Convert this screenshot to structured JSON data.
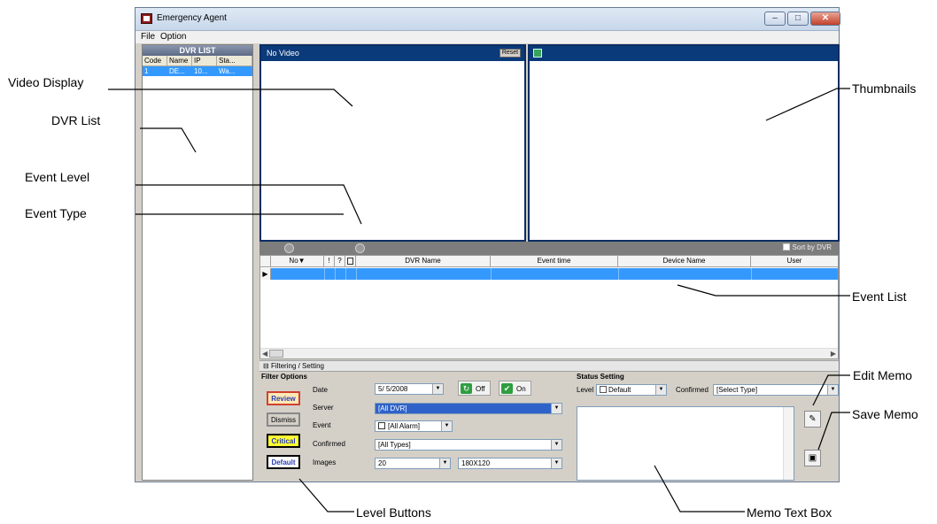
{
  "window": {
    "title": "Emergency Agent",
    "menu": [
      "File",
      "Option"
    ]
  },
  "dvr_list": {
    "header": "DVR LIST",
    "columns": [
      "Code",
      "Name",
      "IP",
      "Sta..."
    ],
    "rows": [
      [
        "1",
        "DE...",
        "10...",
        "Wa..."
      ]
    ]
  },
  "video": {
    "title": "No Video",
    "reset_label": "Reset"
  },
  "event_list": {
    "sort_label": "Sort by DVR",
    "columns": [
      "No▼",
      "!",
      "?",
      "",
      "DVR Name",
      "Event time",
      "Device Name",
      "User"
    ]
  },
  "filtering": {
    "title": "Filtering / Setting",
    "filter_options": "Filter Options",
    "level_buttons": [
      "Review",
      "Dismiss",
      "Critical",
      "Default"
    ],
    "labels": {
      "date": "Date",
      "server": "Server",
      "event": "Event",
      "confirmed": "Confirmed",
      "images": "Images"
    },
    "date_value": "5/ 5/2008",
    "server_value": "[All DVR]",
    "event_value": "[All Alarm]",
    "confirmed_value": "[All Types]",
    "images_count": "20",
    "images_size": "180X120",
    "off_label": "Off",
    "on_label": "On"
  },
  "status_setting": {
    "title": "Status Setting",
    "level_label": "Level",
    "level_value": "Default",
    "confirmed_label": "Confirmed",
    "confirmed_value": "[Select Type]"
  },
  "callouts": {
    "video_display": "Video Display",
    "dvr_list": "DVR List",
    "event_level": "Event Level",
    "event_type": "Event Type",
    "thumbnails": "Thumbnails",
    "event_list": "Event List",
    "edit_memo": "Edit Memo",
    "save_memo": "Save Memo",
    "level_buttons": "Level Buttons",
    "memo_text_box": "Memo Text Box"
  },
  "colors": {
    "title_bar_blue": "#0b3a7a",
    "selection_blue": "#3399ff",
    "review_bg": "#ffe9b3",
    "critical_bg": "#ffff33"
  }
}
